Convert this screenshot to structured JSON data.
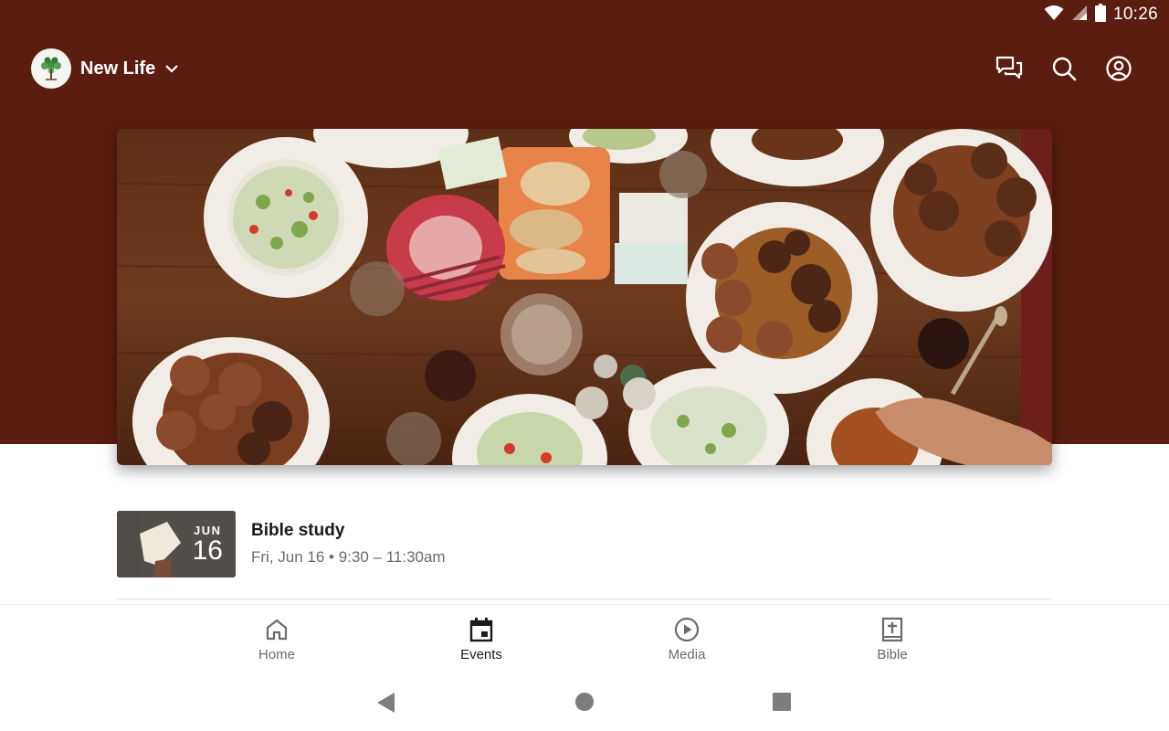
{
  "status_bar": {
    "time": "10:26",
    "icons": [
      "wifi-icon",
      "cell-signal-icon",
      "battery-icon"
    ]
  },
  "header": {
    "org_name": "New Life",
    "logo_icon": "tree-logo-icon",
    "actions": [
      "chat-icon",
      "search-icon",
      "account-icon"
    ],
    "background_color": "#5a1d0f"
  },
  "hero": {
    "image_icon": "shared-meal-photo"
  },
  "events": [
    {
      "month": "JUN",
      "day": "16",
      "title": "Bible study",
      "meta": "Fri, Jun 16 • 9:30 – 11:30am"
    }
  ],
  "bottom_nav": {
    "items": [
      {
        "label": "Home",
        "icon": "home-icon",
        "active": false
      },
      {
        "label": "Events",
        "icon": "calendar-icon",
        "active": true
      },
      {
        "label": "Media",
        "icon": "play-circle-icon",
        "active": false
      },
      {
        "label": "Bible",
        "icon": "bible-icon",
        "active": false
      }
    ]
  },
  "system_nav": [
    "back-icon",
    "home-circle-icon",
    "recents-icon"
  ]
}
